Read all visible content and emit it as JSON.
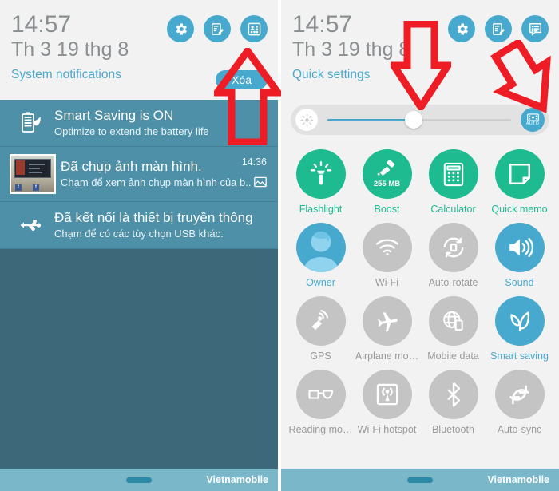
{
  "left_panel": {
    "name": "notification-shade",
    "header": {
      "time": "14:57",
      "date": "Th 3 19 thg 8",
      "subtitle": "System notifications",
      "clear_label": "Xóa",
      "icons": [
        {
          "name": "settings-gear-icon",
          "label": "Settings"
        },
        {
          "name": "edit-quick-settings-icon",
          "label": "Edit"
        },
        {
          "name": "apps-grid-icon",
          "label": "Apps"
        }
      ]
    },
    "notifications": [
      {
        "icon": "battery-leaf-icon",
        "title": "Smart Saving is ON",
        "text": "Optimize to extend the battery life",
        "time": "",
        "badge": ""
      },
      {
        "icon": "screenshot-thumbnail",
        "title": "Đã chụp ảnh màn hình.",
        "text": "Chạm để xem ảnh chụp màn hình của b..",
        "time": "14:36",
        "badge": "image-icon"
      },
      {
        "icon": "usb-icon",
        "title": "Đã kết nối là thiết bị truyền thông",
        "text": "Chạm để có các tùy chọn USB khác.",
        "time": "",
        "badge": ""
      }
    ],
    "footer": {
      "carrier": "Vietnamobile"
    }
  },
  "right_panel": {
    "name": "quick-settings-shade",
    "header": {
      "time": "14:57",
      "date": "Th 3 19 thg 8",
      "subtitle": "Quick settings",
      "icons": [
        {
          "name": "settings-gear-icon",
          "label": "Settings"
        },
        {
          "name": "edit-quick-settings-icon",
          "label": "Edit"
        },
        {
          "name": "notifications-list-icon",
          "label": "Notifications"
        }
      ]
    },
    "brightness": {
      "sun_icon": "brightness-sun-icon",
      "value_percent": 47,
      "auto_label": "AUTO",
      "auto_icon": "auto-brightness-icon",
      "auto_enabled": true
    },
    "tiles": [
      [
        {
          "label": "Flashlight",
          "icon": "flashlight-icon",
          "state": "on-green",
          "sub": ""
        },
        {
          "label": "Boost",
          "icon": "boost-broom-icon",
          "state": "on-green",
          "sub": "255 MB"
        },
        {
          "label": "Calculator",
          "icon": "calculator-icon",
          "state": "on-green",
          "sub": ""
        },
        {
          "label": "Quick memo",
          "icon": "quick-memo-icon",
          "state": "on-green",
          "sub": ""
        }
      ],
      [
        {
          "label": "Owner",
          "icon": "user-avatar-icon",
          "state": "on-blue",
          "sub": ""
        },
        {
          "label": "Wi-Fi",
          "icon": "wifi-icon",
          "state": "off-grey",
          "sub": ""
        },
        {
          "label": "Auto-rotate",
          "icon": "auto-rotate-icon",
          "state": "off-grey",
          "sub": ""
        },
        {
          "label": "Sound",
          "icon": "sound-speaker-icon",
          "state": "on-blue",
          "sub": ""
        }
      ],
      [
        {
          "label": "GPS",
          "icon": "gps-icon",
          "state": "off-grey",
          "sub": ""
        },
        {
          "label": "Airplane mo…",
          "icon": "airplane-icon",
          "state": "off-grey",
          "sub": ""
        },
        {
          "label": "Mobile data",
          "icon": "mobile-data-icon",
          "state": "off-grey",
          "sub": ""
        },
        {
          "label": "Smart saving",
          "icon": "leaf-icon",
          "state": "on-blue",
          "sub": ""
        }
      ],
      [
        {
          "label": "Reading mo…",
          "icon": "reading-glasses-icon",
          "state": "off-grey",
          "sub": ""
        },
        {
          "label": "Wi-Fi hotspot",
          "icon": "hotspot-icon",
          "state": "off-grey",
          "sub": ""
        },
        {
          "label": "Bluetooth",
          "icon": "bluetooth-icon",
          "state": "off-grey",
          "sub": ""
        },
        {
          "label": "Auto-sync",
          "icon": "auto-sync-icon",
          "state": "off-grey",
          "sub": ""
        }
      ]
    ],
    "footer": {
      "carrier": "Vietnamobile"
    }
  },
  "annotations": {
    "color": "#ee1c25",
    "arrows": [
      {
        "name": "arrow-up-apps-grid-icon",
        "direction": "up",
        "target": "apps-grid-icon"
      },
      {
        "name": "arrow-down-brightness-slider",
        "direction": "down",
        "target": "brightness-slider"
      },
      {
        "name": "arrow-down-auto-brightness",
        "direction": "down-left",
        "target": "auto-brightness-button"
      }
    ]
  },
  "colors": {
    "accent_blue": "#48a9ce",
    "accent_green": "#1dbb8f",
    "tile_off_grey": "#c4c4c4",
    "notification_bg": "#4d90a8",
    "shade_bg_dark": "#3c6879",
    "panel_bg": "#f2f2f2",
    "footer_bg": "#79b7c9",
    "annotation_red": "#ee1c25"
  }
}
